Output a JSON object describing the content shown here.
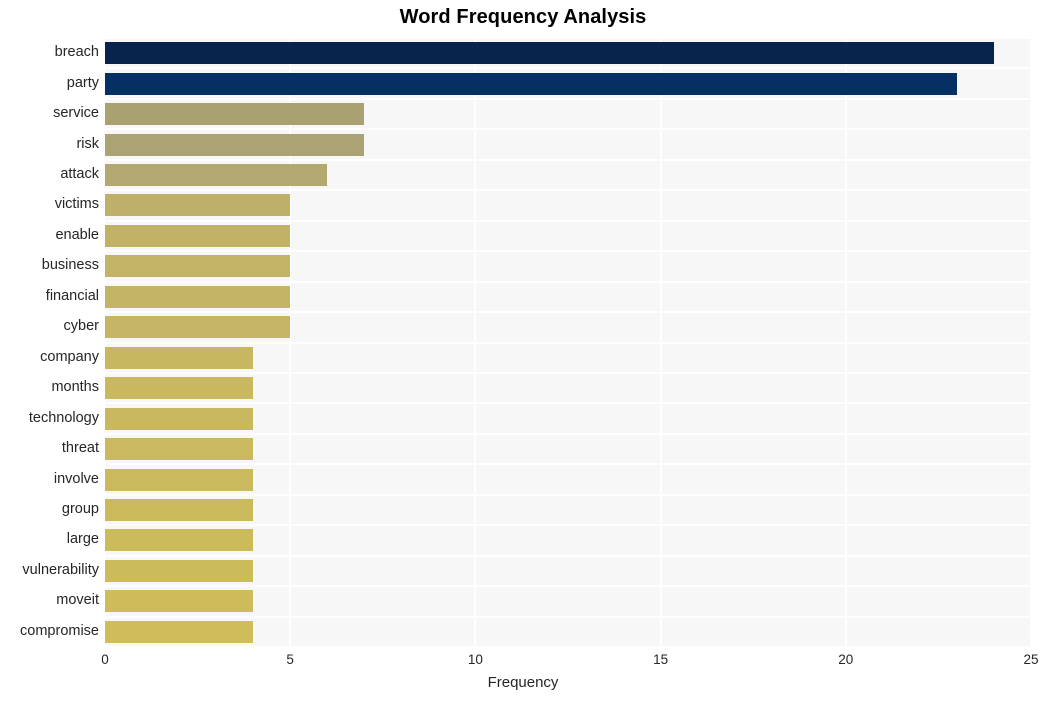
{
  "chart_data": {
    "type": "bar",
    "orientation": "horizontal",
    "title": "Word Frequency Analysis",
    "xlabel": "Frequency",
    "ylabel": "",
    "xlim": [
      0,
      25
    ],
    "xticks": [
      0,
      5,
      10,
      15,
      20,
      25
    ],
    "xtick_labels": [
      "0",
      "5",
      "10",
      "15",
      "20",
      "25"
    ],
    "grid": true,
    "legend": "none",
    "categories": [
      "breach",
      "party",
      "service",
      "risk",
      "attack",
      "victims",
      "enable",
      "business",
      "financial",
      "cyber",
      "company",
      "months",
      "technology",
      "threat",
      "involve",
      "group",
      "large",
      "vulnerability",
      "moveit",
      "compromise"
    ],
    "values": [
      24,
      23,
      7,
      7,
      6,
      5,
      5,
      5,
      5,
      5,
      4,
      4,
      4,
      4,
      4,
      4,
      4,
      4,
      4,
      4
    ],
    "bar_colors": [
      "#07244d",
      "#063063",
      "#aaa173",
      "#aca374",
      "#b3a871",
      "#bfb069",
      "#c2b268",
      "#c3b366",
      "#c4b465",
      "#c5b564",
      "#c8b761",
      "#c9b860",
      "#c9b85f",
      "#cab95e",
      "#cbba5d",
      "#cbba5c",
      "#ccbb5b",
      "#ccbb5a",
      "#cdbc59",
      "#cebd58"
    ],
    "plot_background": "#f7f7f7",
    "grid_color": "#ffffff",
    "text_color": "#262626",
    "figure_background": "#ffffff"
  }
}
